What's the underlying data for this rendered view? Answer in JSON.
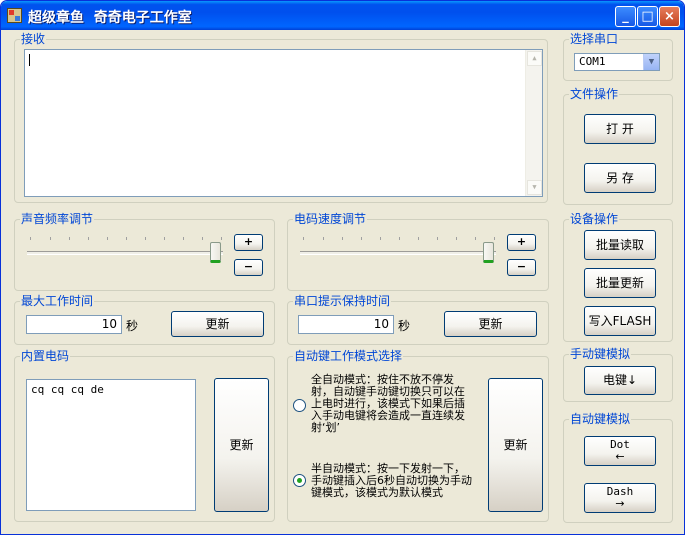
{
  "window": {
    "title": "超级章鱼  奇奇电子工作室",
    "controls": {
      "minimize": "_",
      "maximize": "□",
      "close": "×"
    }
  },
  "receive": {
    "legend": "接收",
    "text": "",
    "scroll_up": "▲",
    "scroll_down": "▼"
  },
  "serial_port": {
    "legend": "选择串口",
    "selected": "COM1",
    "arrow": "▼"
  },
  "file_ops": {
    "legend": "文件操作",
    "open_label": "打 开",
    "save_as_label": "另 存"
  },
  "device_ops": {
    "legend": "设备操作",
    "batch_read_label": "批量读取",
    "batch_update_label": "批量更新",
    "write_flash_label": "写入FLASH"
  },
  "sound_freq": {
    "legend": "声音频率调节",
    "plus": "+",
    "minus": "−",
    "level": 1.0
  },
  "code_speed": {
    "legend": "电码速度调节",
    "plus": "+",
    "minus": "−",
    "level": 1.0
  },
  "max_work_time": {
    "legend": "最大工作时间",
    "value": "10",
    "unit": "秒",
    "update_label": "更新"
  },
  "port_hint_time": {
    "legend": "串口提示保持时间",
    "value": "10",
    "unit": "秒",
    "update_label": "更新"
  },
  "manual_key": {
    "legend": "手动键模拟",
    "key_label": "电键↓"
  },
  "builtin_code": {
    "legend": "内置电码",
    "text": "cq cq cq de",
    "update_label": "更新"
  },
  "auto_mode": {
    "legend": "自动键工作模式选择",
    "full_auto": {
      "line1": "全自动模式：按住不放不停发",
      "line2": "射，自动键手动键切换只可以在",
      "line3": "上电时进行，该模式下如果后插",
      "line4": "入手动电键将会造成一直连续发",
      "line5": "射‘划’"
    },
    "semi_auto": {
      "line1": "半自动模式：按一下发射一下，",
      "line2": "手动键插入后6秒自动切换为手动",
      "line3": "键模式，该模式为默认模式"
    },
    "selected": "semi_auto",
    "update_label": "更新"
  },
  "auto_key": {
    "legend": "自动键模拟",
    "dot_label": "Dot",
    "dot_arrow": "←",
    "dash_label": "Dash",
    "dash_arrow": "→"
  },
  "colors": {
    "legend_blue": "#0046d5",
    "titlebar_blue": "#0050ee",
    "thumb_green": "#21a121"
  }
}
